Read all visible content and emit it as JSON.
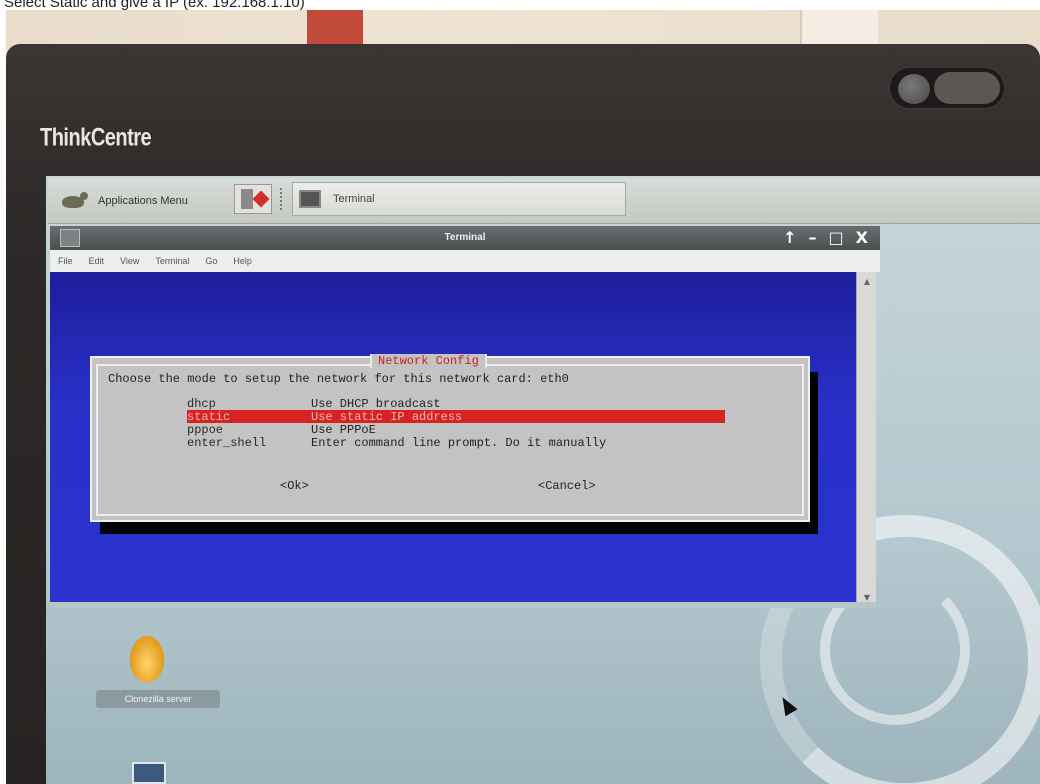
{
  "caption": "Select Static and give a IP (ex. 192.168.1.10)",
  "monitor": {
    "brand": "ThinkCentre"
  },
  "panel": {
    "applications_menu": "Applications Menu",
    "task_terminal": "Terminal"
  },
  "terminal": {
    "title": "Terminal",
    "window_buttons": [
      "↑",
      "–",
      "□",
      "X"
    ],
    "menu": [
      "File",
      "Edit",
      "View",
      "Terminal",
      "Go",
      "Help"
    ]
  },
  "dialog": {
    "title": "Network Config",
    "prompt": "Choose the mode to setup the network for this network card: eth0",
    "options": [
      {
        "tag": "dhcp",
        "desc": "Use DHCP broadcast"
      },
      {
        "tag": "static",
        "desc": "Use static IP address"
      },
      {
        "tag": "pppoe",
        "desc": "Use PPPoE"
      },
      {
        "tag": "enter_shell",
        "desc": "Enter command line prompt. Do it manually"
      }
    ],
    "selected_index": 1,
    "ok_label": "<Ok>",
    "cancel_label": "<Cancel>"
  },
  "desktop": {
    "clonezilla_label": "Clonezilla server"
  },
  "colors": {
    "terminal_bg": "#2a33d0",
    "dialog_bg": "#c3c3c3",
    "dialog_title": "#c62020",
    "selection": "#d72222"
  }
}
